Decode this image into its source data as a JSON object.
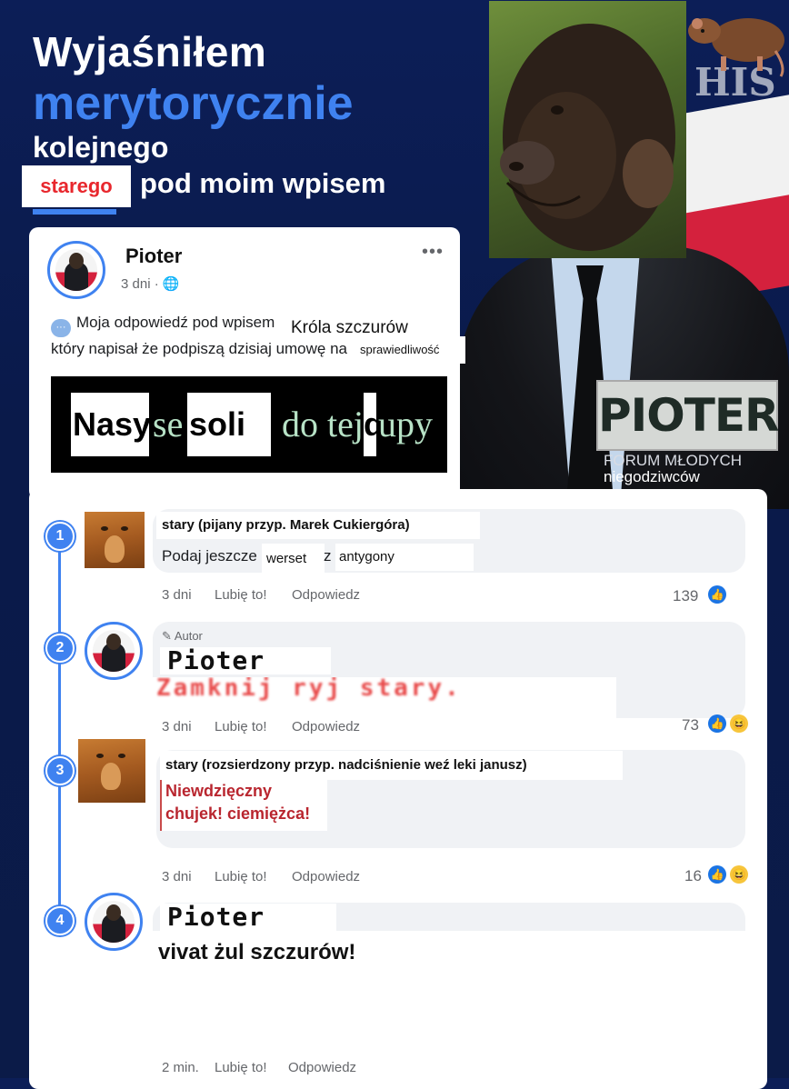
{
  "header": {
    "line1": "Wyjaśniłem",
    "line2": "merytorycznie",
    "line3": "kolejnego",
    "highlight": "starego",
    "line4": "pod moim wpisem"
  },
  "watermark": "HIS",
  "post": {
    "author": "Pioter",
    "time": "3 dni ·",
    "more": "•••",
    "text1": "Moja odpowiedź pod wpisem",
    "text2": "który napisał że podpiszą dzisiaj umowę na",
    "krola": "Króla szczurów",
    "sprawiedliwosc": "sprawiedliwość",
    "banner": {
      "w1": "Nasyp",
      "w2": "se",
      "w3": "soli",
      "w4": "do tej",
      "w5": "d",
      "w6": "upy"
    }
  },
  "logo": {
    "title": "PIOTER",
    "sub1": "FORUM MŁODYCH",
    "sub2": "niegodziwców"
  },
  "comments": [
    {
      "step": "1",
      "name": "stary (pijany przyp. Marek Cukiergóra)",
      "text_a": "Podaj jeszcze",
      "text_b": "werset",
      "text_c": "z",
      "text_d": "antygony",
      "time": "3 dni",
      "like": "Lubię to!",
      "reply": "Odpowiedz",
      "count": "139"
    },
    {
      "step": "2",
      "badge": "Autor",
      "name": "Pioter",
      "text": "Zamknij ryj stary.",
      "time": "3 dni",
      "like": "Lubię to!",
      "reply": "Odpowiedz",
      "count": "73"
    },
    {
      "step": "3",
      "name": "stary (rozsierdzony przyp. nadciśnienie weź leki janusz)",
      "text_line1": "Niewdzięczny",
      "text_line2": "chujek! ciemiężca!",
      "time": "3 dni",
      "like": "Lubię to!",
      "reply": "Odpowiedz",
      "count": "16"
    },
    {
      "step": "4",
      "name": "Pioter",
      "text": "vivat żul szczurów!",
      "time": "2 min.",
      "like": "Lubię to!",
      "reply": "Odpowiedz"
    }
  ],
  "colors": {
    "background": "#0c1e57",
    "accent_blue": "#3f82f0",
    "red": "#e8272d",
    "like_blue": "#1b74e4"
  }
}
